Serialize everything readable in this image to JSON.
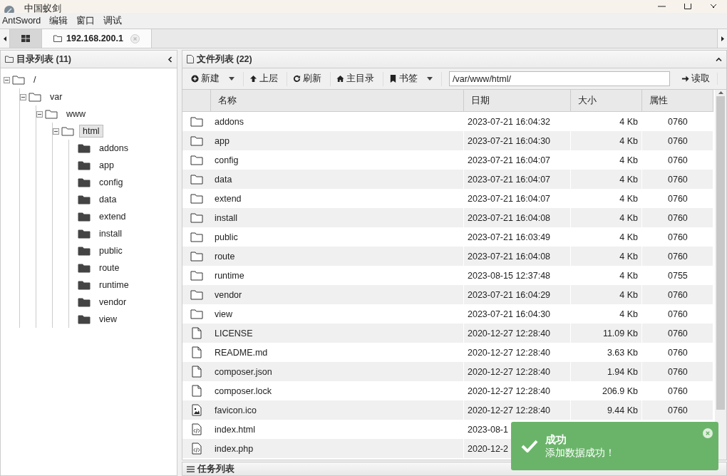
{
  "window": {
    "title": "中国蚁剑"
  },
  "menu": [
    "AntSword",
    "编辑",
    "窗口",
    "调试"
  ],
  "tabs": [
    {
      "kind": "home",
      "selected": false
    },
    {
      "kind": "shell",
      "label": "192.168.200.1",
      "selected": true
    }
  ],
  "dir_panel": {
    "title": "目录列表 (11)",
    "tree": [
      {
        "label": "/",
        "expanded": true,
        "selected": false,
        "children": [
          {
            "label": "var",
            "expanded": true,
            "selected": false,
            "children": [
              {
                "label": "www",
                "expanded": true,
                "selected": false,
                "children": [
                  {
                    "label": "html",
                    "expanded": true,
                    "selected": true,
                    "children": [
                      {
                        "label": "addons",
                        "selected": false
                      },
                      {
                        "label": "app",
                        "selected": false
                      },
                      {
                        "label": "config",
                        "selected": false
                      },
                      {
                        "label": "data",
                        "selected": false
                      },
                      {
                        "label": "extend",
                        "selected": false
                      },
                      {
                        "label": "install",
                        "selected": false
                      },
                      {
                        "label": "public",
                        "selected": false
                      },
                      {
                        "label": "route",
                        "selected": false
                      },
                      {
                        "label": "runtime",
                        "selected": false
                      },
                      {
                        "label": "vendor",
                        "selected": false
                      },
                      {
                        "label": "view",
                        "selected": false
                      }
                    ]
                  }
                ]
              }
            ]
          }
        ]
      }
    ]
  },
  "file_panel": {
    "title": "文件列表 (22)",
    "toolbar": [
      {
        "kind": "plus",
        "label": "新建",
        "dropdown": true
      },
      {
        "kind": "up",
        "label": "上层",
        "dropdown": false
      },
      {
        "kind": "refresh",
        "label": "刷新",
        "dropdown": false
      },
      {
        "kind": "home",
        "label": "主目录",
        "dropdown": false
      },
      {
        "kind": "bookmark",
        "label": "书签",
        "dropdown": true
      }
    ],
    "path": "/var/www/html/",
    "read_button": "读取",
    "columns": [
      "名称",
      "日期",
      "大小",
      "属性"
    ],
    "rows": [
      {
        "kind": "folder",
        "name": "addons",
        "date": "2023-07-21 16:04:32",
        "size": "4 Kb",
        "perm": "0760"
      },
      {
        "kind": "folder",
        "name": "app",
        "date": "2023-07-21 16:04:30",
        "size": "4 Kb",
        "perm": "0760"
      },
      {
        "kind": "folder",
        "name": "config",
        "date": "2023-07-21 16:04:07",
        "size": "4 Kb",
        "perm": "0760"
      },
      {
        "kind": "folder",
        "name": "data",
        "date": "2023-07-21 16:04:07",
        "size": "4 Kb",
        "perm": "0760"
      },
      {
        "kind": "folder",
        "name": "extend",
        "date": "2023-07-21 16:04:07",
        "size": "4 Kb",
        "perm": "0760"
      },
      {
        "kind": "folder",
        "name": "install",
        "date": "2023-07-21 16:04:08",
        "size": "4 Kb",
        "perm": "0760"
      },
      {
        "kind": "folder",
        "name": "public",
        "date": "2023-07-21 16:03:49",
        "size": "4 Kb",
        "perm": "0760"
      },
      {
        "kind": "folder",
        "name": "route",
        "date": "2023-07-21 16:04:08",
        "size": "4 Kb",
        "perm": "0760"
      },
      {
        "kind": "folder",
        "name": "runtime",
        "date": "2023-08-15 12:37:48",
        "size": "4 Kb",
        "perm": "0755"
      },
      {
        "kind": "folder",
        "name": "vendor",
        "date": "2023-07-21 16:04:29",
        "size": "4 Kb",
        "perm": "0760"
      },
      {
        "kind": "folder",
        "name": "view",
        "date": "2023-07-21 16:04:30",
        "size": "4 Kb",
        "perm": "0760"
      },
      {
        "kind": "file",
        "name": "LICENSE",
        "date": "2020-12-27 12:28:40",
        "size": "11.09 Kb",
        "perm": "0760"
      },
      {
        "kind": "file",
        "name": "README.md",
        "date": "2020-12-27 12:28:40",
        "size": "3.63 Kb",
        "perm": "0760"
      },
      {
        "kind": "file",
        "name": "composer.json",
        "date": "2020-12-27 12:28:40",
        "size": "1.94 Kb",
        "perm": "0760"
      },
      {
        "kind": "file",
        "name": "composer.lock",
        "date": "2020-12-27 12:28:40",
        "size": "206.9 Kb",
        "perm": "0760"
      },
      {
        "kind": "image",
        "name": "favicon.ico",
        "date": "2020-12-27 12:28:40",
        "size": "9.44 Kb",
        "perm": "0760"
      },
      {
        "kind": "code",
        "name": "index.html",
        "date": "2023-08-1"
      },
      {
        "kind": "code",
        "name": "index.php",
        "date": "2020-12-2"
      }
    ]
  },
  "task_panel": {
    "title": "任务列表"
  },
  "toast": {
    "title": "成功",
    "message": "添加数据成功！"
  }
}
